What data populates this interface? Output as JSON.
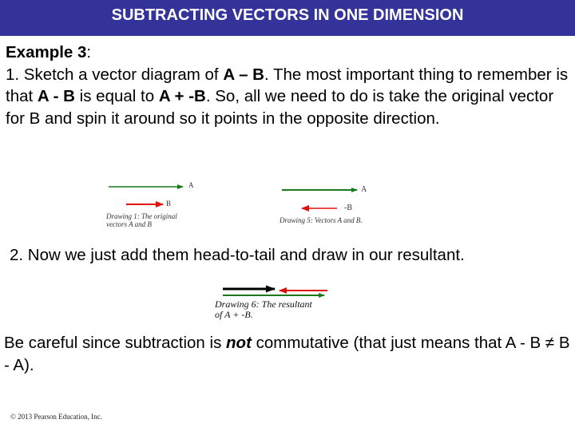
{
  "header": {
    "title": "SUBTRACTING VECTORS IN ONE DIMENSION"
  },
  "example": {
    "heading": "Example 3",
    "heading_colon": ":",
    "step1": {
      "t1": "1. Sketch a vector diagram of ",
      "b1": "A – B",
      "t2": ". The most important thing to remember is that ",
      "b2": "A - B",
      "t3": " is equal to ",
      "b3": "A + -B",
      "t4": ". So, all we need to do is take the original vector for B and spin it around so it points in the opposite direction."
    },
    "step2": "2. Now we just add them head-to-tail and draw in our resultant.",
    "note": {
      "t1": "Be careful since subtraction is ",
      "em": "not",
      "t2": " commutative (that just means that A - B ≠ B - A)."
    }
  },
  "drawings": {
    "drawing1": {
      "label_a": "A",
      "label_b": "B",
      "caption_line1": "Drawing 1: The original",
      "caption_line2": "vectors A and B"
    },
    "drawing5": {
      "label_a": "A",
      "label_b": "-B",
      "caption": "Drawing 5: Vectors A and  B."
    },
    "drawing6": {
      "caption_line1": "Drawing 6: The resultant",
      "caption_line2": "of A + -B."
    }
  },
  "colors": {
    "header_bg": "#333399",
    "vector_a": "#1a7a1a",
    "vector_b": "#e01010",
    "resultant": "#000000"
  },
  "footer": {
    "copyright": "© 2013 Pearson Education, Inc."
  }
}
